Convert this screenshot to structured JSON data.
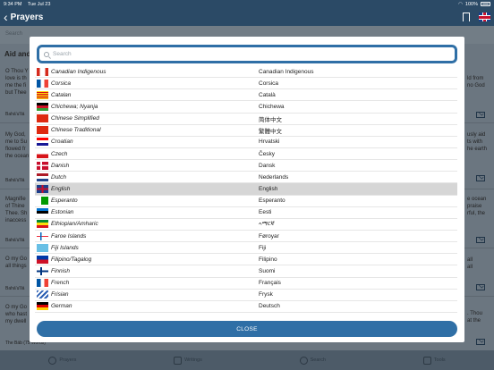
{
  "status_bar": {
    "time": "9:34 PM",
    "date": "Tue Jul 23",
    "battery": "100%"
  },
  "nav": {
    "back_glyph": "‹",
    "title": "Prayers"
  },
  "background": {
    "search_placeholder": "Search",
    "heading": "Aid and",
    "snippets": [
      {
        "left": "O Thou Y\nlove is th\nme the fi\nbut Thee",
        "right": "ld from\nno God"
      },
      {
        "left": "My God,\nme to Su\nflowed fr\nthe ocean",
        "right": "usly aid\nts with\nhe earth"
      },
      {
        "left": "Magnifie\nof Thine\nThee. Sh\ninaccess",
        "right": "e ocean\npraise\nrful, the"
      },
      {
        "left": "O my Go\nall things",
        "right": "all\nall"
      },
      {
        "left": "O my Go\nwho hast\nmy dwell",
        "right": ". Thou\nat the"
      }
    ],
    "authors": [
      "Bahá'u'llá",
      "Bahá'u'llá",
      "Bahá'u'llá",
      "Bahá'u'llá"
    ],
    "footer_item": "The Báb (75 Words)"
  },
  "tabs": [
    {
      "label": "Prayers"
    },
    {
      "label": "Writings"
    },
    {
      "label": "Search"
    },
    {
      "label": "Tools"
    }
  ],
  "modal": {
    "search_placeholder": "Search",
    "close_label": "CLOSE",
    "languages": [
      {
        "english": "Canadian Indigenous",
        "native": "Canadian Indigenous",
        "flag": "canada",
        "selected": false
      },
      {
        "english": "Corsica",
        "native": "Corsica",
        "flag": "france",
        "selected": false
      },
      {
        "english": "Catalan",
        "native": "Català",
        "flag": "catalonia",
        "selected": false
      },
      {
        "english": "Chichewa; Nyanja",
        "native": "Chichewa",
        "flag": "malawi",
        "selected": false
      },
      {
        "english": "Chinese Simplified",
        "native": "简体中文",
        "flag": "china",
        "selected": false
      },
      {
        "english": "Chinese Traditional",
        "native": "繁體中文",
        "flag": "china",
        "selected": false
      },
      {
        "english": "Croatian",
        "native": "Hrvatski",
        "flag": "croatia",
        "selected": false
      },
      {
        "english": "Czech",
        "native": "Česky",
        "flag": "czech",
        "selected": false
      },
      {
        "english": "Danish",
        "native": "Dansk",
        "flag": "denmark",
        "selected": false
      },
      {
        "english": "Dutch",
        "native": "Nederlands",
        "flag": "netherlands",
        "selected": false
      },
      {
        "english": "English",
        "native": "English",
        "flag": "uk",
        "selected": true
      },
      {
        "english": "Esperanto",
        "native": "Esperanto",
        "flag": "esperanto",
        "selected": false
      },
      {
        "english": "Estonian",
        "native": "Eesti",
        "flag": "estonia",
        "selected": false
      },
      {
        "english": "Ethiopian/Amharic",
        "native": "ኣማርኛ",
        "flag": "ethiopia",
        "selected": false
      },
      {
        "english": "Faroe Islands",
        "native": "Føroyar",
        "flag": "faroe",
        "selected": false
      },
      {
        "english": "Fiji Islands",
        "native": "Fiji",
        "flag": "fiji",
        "selected": false
      },
      {
        "english": "Filipino/Tagalog",
        "native": "Filipino",
        "flag": "philippines",
        "selected": false
      },
      {
        "english": "Finnish",
        "native": "Suomi",
        "flag": "finland",
        "selected": false
      },
      {
        "english": "French",
        "native": "Français",
        "flag": "france",
        "selected": false
      },
      {
        "english": "Frisian",
        "native": "Frysk",
        "flag": "frisian",
        "selected": false
      },
      {
        "english": "German",
        "native": "Deutsch",
        "flag": "germany",
        "selected": false
      }
    ]
  }
}
